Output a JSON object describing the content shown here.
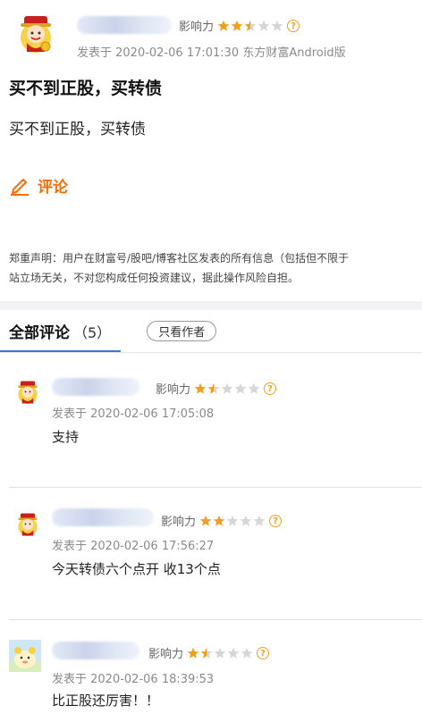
{
  "post": {
    "influence_label": "影响力",
    "influence_rating": 2.5,
    "meta": "发表于 2020-02-06 17:01:30 东方财富Android版",
    "title": "买不到正股，买转债",
    "body": "买不到正股，买转债",
    "comment_link": "评论"
  },
  "disclaimer": {
    "line1": "郑重声明：用户在财富号/股吧/博客社区发表的所有信息（包括但不限于",
    "line2": "站立场无关，不对您构成任何投资建议，据此操作风险自担。"
  },
  "tabs": {
    "all_label": "全部评论",
    "count": "（5）",
    "only_author": "只看作者"
  },
  "comments": [
    {
      "influence_label": "影响力",
      "influence_rating": 1.5,
      "meta": "发表于 2020-02-06 17:05:08",
      "text": "支持"
    },
    {
      "influence_label": "影响力",
      "influence_rating": 2,
      "meta": "发表于 2020-02-06 17:56:27",
      "text": "今天转债六个点开 收13个点"
    },
    {
      "influence_label": "影响力",
      "influence_rating": 1.5,
      "meta": "发表于 2020-02-06 18:39:53",
      "text": "比正股还厉害！！"
    }
  ],
  "colors": {
    "accent": "#ff6a00",
    "star": "#f0a020",
    "star_empty": "#d6d6d6",
    "tab_underline": "#3a78d8"
  }
}
